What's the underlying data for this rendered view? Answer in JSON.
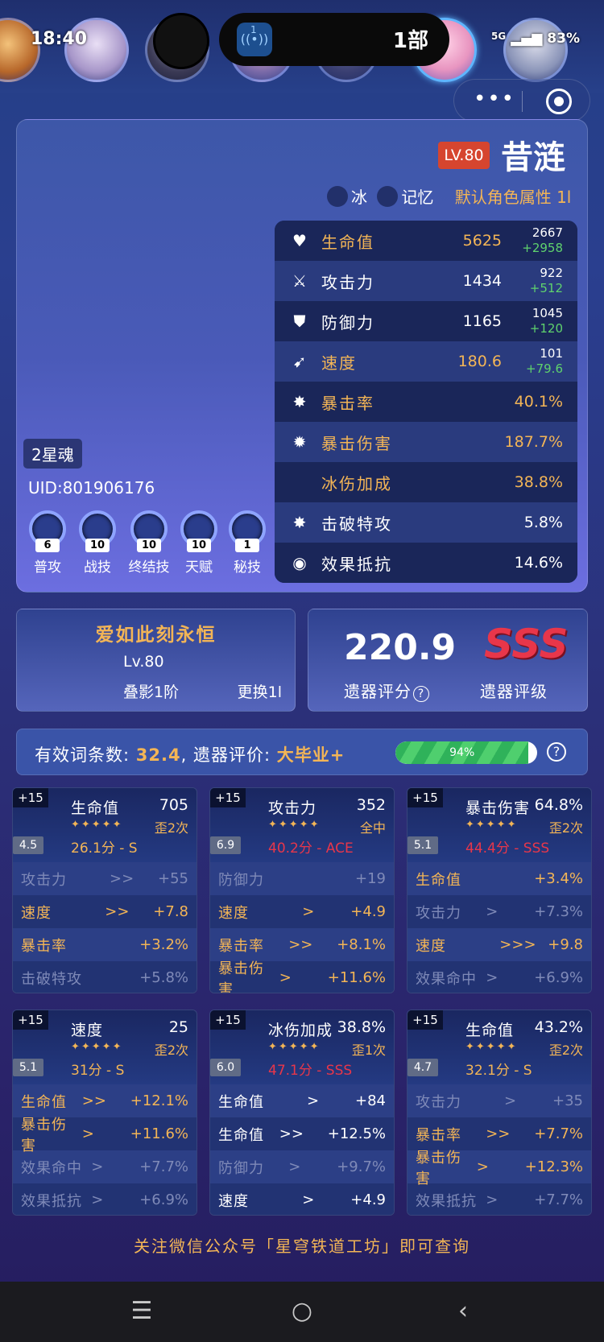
{
  "status": {
    "time": "18:40",
    "battery": "83%",
    "network": "5G"
  },
  "island": {
    "icon": "broadcast-icon",
    "badge": "1",
    "text": "1部"
  },
  "character": {
    "level": "LV.80",
    "name": "昔涟",
    "element": "冰",
    "path": "记忆",
    "default_attr": "默认角色属性 1l",
    "eidolon": "2星魂",
    "uid": "UID:801906176",
    "stats": [
      {
        "icon": "heart-icon",
        "name": "生命值",
        "value": "5625",
        "base": "2667",
        "add": "+2958",
        "gold": true
      },
      {
        "icon": "sword-icon",
        "name": "攻击力",
        "value": "1434",
        "base": "922",
        "add": "+512",
        "gold": false
      },
      {
        "icon": "shield-icon",
        "name": "防御力",
        "value": "1165",
        "base": "1045",
        "add": "+120",
        "gold": false
      },
      {
        "icon": "boot-icon",
        "name": "速度",
        "value": "180.6",
        "base": "101",
        "add": "+79.6",
        "gold": true
      },
      {
        "icon": "crit-icon",
        "name": "暴击率",
        "value": "40.1%",
        "base": "",
        "add": "",
        "gold": true
      },
      {
        "icon": "crit-dmg-icon",
        "name": "暴击伤害",
        "value": "187.7%",
        "base": "",
        "add": "",
        "gold": true
      },
      {
        "icon": "",
        "name": "冰伤加成",
        "value": "38.8%",
        "base": "",
        "add": "",
        "gold": true
      },
      {
        "icon": "break-icon",
        "name": "击破特攻",
        "value": "5.8%",
        "base": "",
        "add": "",
        "gold": false
      },
      {
        "icon": "resist-icon",
        "name": "效果抵抗",
        "value": "14.6%",
        "base": "",
        "add": "",
        "gold": false
      }
    ],
    "skills": [
      {
        "label": "普攻",
        "level": "6"
      },
      {
        "label": "战技",
        "level": "10"
      },
      {
        "label": "终结技",
        "level": "10"
      },
      {
        "label": "天赋",
        "level": "10"
      },
      {
        "label": "秘技",
        "level": "1"
      }
    ]
  },
  "light_cone": {
    "name": "爱如此刻永恒",
    "level": "Lv.80",
    "superimpose": "叠影1阶",
    "swap": "更换1l"
  },
  "score": {
    "value": "220.9",
    "value_label": "遗器评分",
    "grade": "SSS",
    "grade_label": "遗器评级"
  },
  "summary": {
    "count_label": "有效词条数:",
    "count": "32.4",
    "eval_label": ", 遗器评价:",
    "eval": "大毕业+",
    "progress_text": "94%",
    "progress": 0.94
  },
  "relics": [
    {
      "plus": "+15",
      "score": "4.5",
      "main": "生命值",
      "main_value": "705",
      "stars": "✦✦✦✦✦",
      "rolls": "歪2次",
      "rating": "26.1分 - S",
      "rating_color": "gold",
      "subs": [
        {
          "name": "攻击力",
          "arrow": ">>",
          "value": "+55",
          "state": "off"
        },
        {
          "name": "速度",
          "arrow": ">>",
          "value": "+7.8",
          "state": "on"
        },
        {
          "name": "暴击率",
          "arrow": "",
          "value": "+3.2%",
          "state": "on"
        },
        {
          "name": "击破特攻",
          "arrow": "",
          "value": "+5.8%",
          "state": "off"
        }
      ]
    },
    {
      "plus": "+15",
      "score": "6.9",
      "main": "攻击力",
      "main_value": "352",
      "stars": "✦✦✦✦✦",
      "rolls": "全中",
      "rating": "40.2分 - ACE",
      "rating_color": "red",
      "subs": [
        {
          "name": "防御力",
          "arrow": "",
          "value": "+19",
          "state": "off"
        },
        {
          "name": "速度",
          "arrow": ">",
          "value": "+4.9",
          "state": "on"
        },
        {
          "name": "暴击率",
          "arrow": ">>",
          "value": "+8.1%",
          "state": "on"
        },
        {
          "name": "暴击伤害",
          "arrow": ">",
          "value": "+11.6%",
          "state": "on"
        }
      ]
    },
    {
      "plus": "+15",
      "score": "5.1",
      "main": "暴击伤害",
      "main_value": "64.8%",
      "stars": "✦✦✦✦✦",
      "rolls": "歪2次",
      "rating": "44.4分 - SSS",
      "rating_color": "red",
      "subs": [
        {
          "name": "生命值",
          "arrow": "",
          "value": "+3.4%",
          "state": "on"
        },
        {
          "name": "攻击力",
          "arrow": ">",
          "value": "+7.3%",
          "state": "off"
        },
        {
          "name": "速度",
          "arrow": ">>>",
          "value": "+9.8",
          "state": "on"
        },
        {
          "name": "效果命中",
          "arrow": ">",
          "value": "+6.9%",
          "state": "off"
        }
      ]
    },
    {
      "plus": "+15",
      "score": "5.1",
      "main": "速度",
      "main_value": "25",
      "stars": "✦✦✦✦✦",
      "rolls": "歪2次",
      "rating": "31分 - S",
      "rating_color": "gold",
      "subs": [
        {
          "name": "生命值",
          "arrow": ">>",
          "value": "+12.1%",
          "state": "on"
        },
        {
          "name": "暴击伤害",
          "arrow": ">",
          "value": "+11.6%",
          "state": "on"
        },
        {
          "name": "效果命中",
          "arrow": ">",
          "value": "+7.7%",
          "state": "off"
        },
        {
          "name": "效果抵抗",
          "arrow": ">",
          "value": "+6.9%",
          "state": "off"
        }
      ]
    },
    {
      "plus": "+15",
      "score": "6.0",
      "main": "冰伤加成",
      "main_value": "38.8%",
      "stars": "✦✦✦✦✦",
      "rolls": "歪1次",
      "rating": "47.1分 - SSS",
      "rating_color": "red",
      "subs": [
        {
          "name": "生命值",
          "arrow": ">",
          "value": "+84",
          "state": "onw"
        },
        {
          "name": "生命值",
          "arrow": ">>",
          "value": "+12.5%",
          "state": "onw"
        },
        {
          "name": "防御力",
          "arrow": ">",
          "value": "+9.7%",
          "state": "off"
        },
        {
          "name": "速度",
          "arrow": ">",
          "value": "+4.9",
          "state": "onw"
        }
      ]
    },
    {
      "plus": "+15",
      "score": "4.7",
      "main": "生命值",
      "main_value": "43.2%",
      "stars": "✦✦✦✦✦",
      "rolls": "歪2次",
      "rating": "32.1分 - S",
      "rating_color": "gold",
      "subs": [
        {
          "name": "攻击力",
          "arrow": ">",
          "value": "+35",
          "state": "off"
        },
        {
          "name": "暴击率",
          "arrow": ">>",
          "value": "+7.7%",
          "state": "on"
        },
        {
          "name": "暴击伤害",
          "arrow": ">",
          "value": "+12.3%",
          "state": "on"
        },
        {
          "name": "效果抵抗",
          "arrow": ">",
          "value": "+7.7%",
          "state": "off"
        }
      ]
    }
  ],
  "footer": "关注微信公众号「星穹铁道工坊」即可查询",
  "nav": {
    "menu": "menu-icon",
    "home": "home-icon",
    "back": "back-icon"
  },
  "colors": {
    "gold": "#f3b556",
    "red": "#e8364a",
    "green": "#5fd26d",
    "badge": "#d6452f"
  }
}
